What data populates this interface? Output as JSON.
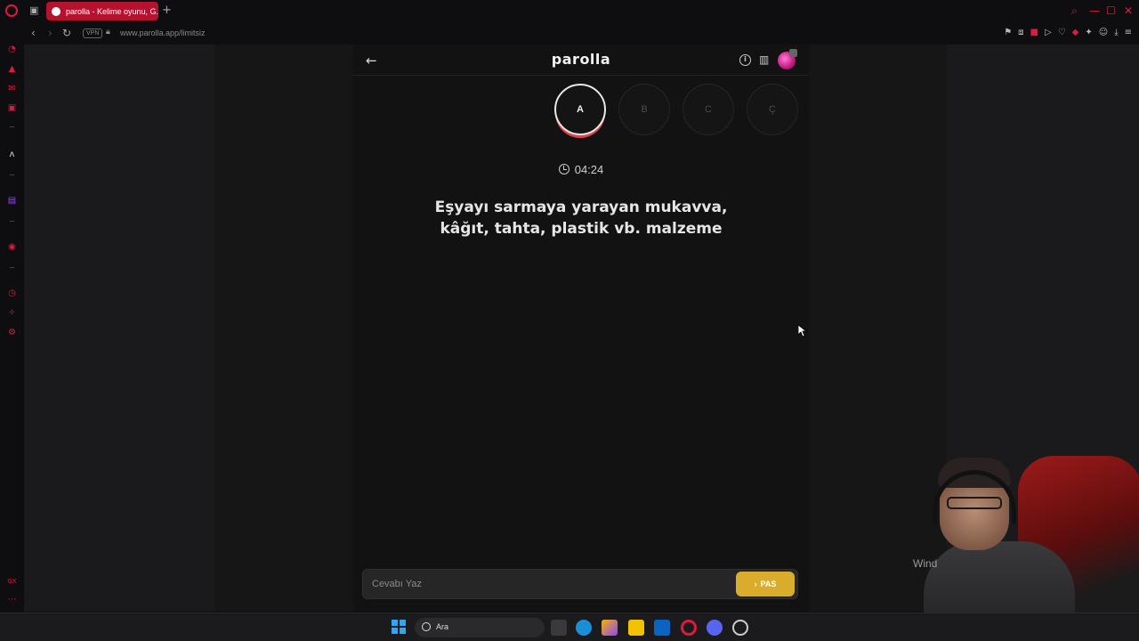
{
  "browser": {
    "tab_title": "parolla - Kelime oyunu, G...",
    "url": "www.parolla.app/limitsiz",
    "vpn_label": "VPN",
    "accent_color": "#e01a3f"
  },
  "app": {
    "logo": "parolla",
    "letters": [
      {
        "label": "A",
        "state": "active"
      },
      {
        "label": "B",
        "state": "idle"
      },
      {
        "label": "C",
        "state": "idle"
      },
      {
        "label": "Ç",
        "state": "idle"
      }
    ],
    "timer": "04:24",
    "question_line1": "Eşyayı sarmaya yarayan mukavva,",
    "question_line2": "kâğıt, tahta, plastik vb. malzeme",
    "answer_placeholder": "Cevabı Yaz",
    "pass_label": "PAS",
    "pass_color": "#d9ad2b"
  },
  "overlay": {
    "watermark": "Wind"
  },
  "taskbar": {
    "search_label": "Ara"
  }
}
